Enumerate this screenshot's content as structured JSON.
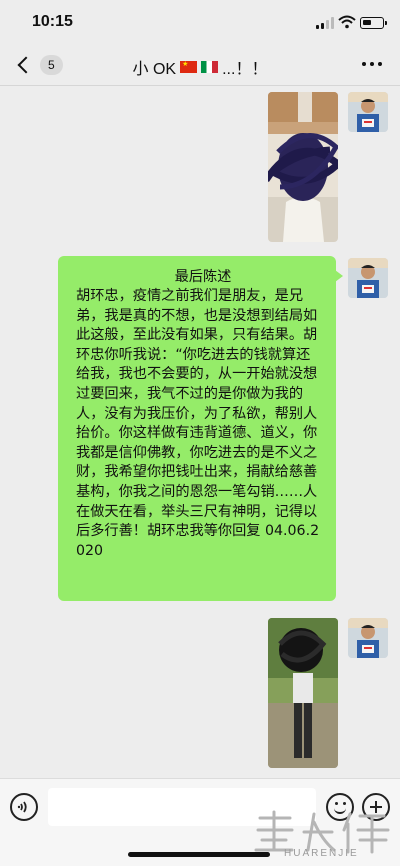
{
  "status_bar": {
    "time": "10:15"
  },
  "nav": {
    "unread_count": "5",
    "title_prefix": "小 OK",
    "title_suffix": "...！！"
  },
  "message": {
    "title": "最后陈述",
    "body": "胡环忠，疫情之前我们是朋友，是兄弟，我是真的不想，也是没想到结局如此这般，至此没有如果，只有结果。胡环忠你听我说：“你吃进去的钱就算还给我，我也不会要的，从一开始就没想过要回来，我气不过的是你做为我的人，没有为我压价，为了私欲，帮别人抬价。你这样做有违背道德、道义，你我都是信仰佛教，你吃进去的是不义之财，我希望你把钱吐出来，捐献给慈善基构，你我之间的恩怨一笔勾销……人在做天在看，举头三尺有神明，记得以后多行善！胡环忠我等你回复 04.06.2020"
  },
  "watermark": {
    "text": "HUARENJIE",
    "logo": "華人街"
  },
  "colors": {
    "bubble": "#95ec69",
    "background": "#ededed"
  }
}
